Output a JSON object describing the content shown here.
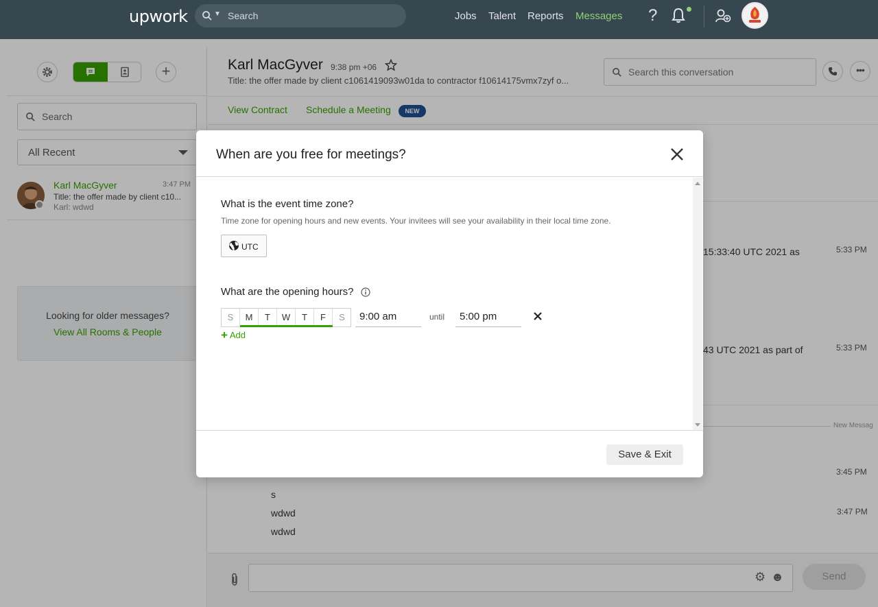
{
  "nav": {
    "logo": "upwork",
    "search_placeholder": "Search",
    "links": [
      "Jobs",
      "Talent",
      "Reports",
      "Messages"
    ],
    "active_link": "Messages",
    "help_label": "?",
    "accent": "#8fd07a"
  },
  "sidebar": {
    "search_placeholder": "Search",
    "filter_value": "All Recent",
    "rooms": [
      {
        "name": "Karl MacGyver",
        "time": "3:47 PM",
        "title": "Title: the offer made by client c10...",
        "last": "Karl: wdwd"
      }
    ],
    "older_prompt": "Looking for older messages?",
    "older_link": "View All Rooms & People"
  },
  "conversation": {
    "name": "Karl MacGyver",
    "local_time": "9:38 pm +06",
    "title": "Title: the offer made by client c1061419093w01da to contractor f10614175vmx7zyf o...",
    "search_placeholder": "Search this conversation",
    "tabs": [
      "View Contract",
      "Schedule a Meeting"
    ],
    "new_badge": "NEW",
    "messages": [
      {
        "text": "15:33:40 UTC 2021 as",
        "time": "5:33 PM"
      },
      {
        "text": "43 UTC 2021 as part of",
        "time": "5:33 PM"
      },
      {
        "text": "",
        "time": "3:45 PM"
      },
      {
        "text": "s",
        "time": ""
      },
      {
        "text": "wdwd",
        "time": "3:47 PM"
      },
      {
        "text": "wdwd",
        "time": ""
      }
    ],
    "new_messages_label": "New Messag",
    "send_label": "Send"
  },
  "modal": {
    "title": "When are you free for meetings?",
    "timezone_question": "What is the event time zone?",
    "timezone_hint": "Time zone for opening hours and new events. Your invitees will see your availability in their local time zone.",
    "timezone_value": "UTC",
    "hours_question": "What are the opening hours?",
    "days": [
      {
        "label": "S",
        "selected": false
      },
      {
        "label": "M",
        "selected": true
      },
      {
        "label": "T",
        "selected": true
      },
      {
        "label": "W",
        "selected": true
      },
      {
        "label": "T",
        "selected": true
      },
      {
        "label": "F",
        "selected": true
      },
      {
        "label": "S",
        "selected": false
      }
    ],
    "start_time": "9:00 am",
    "until_label": "until",
    "end_time": "5:00 pm",
    "add_label": "Add",
    "save_label": "Save & Exit"
  },
  "colors": {
    "nav_bg": "#37474f",
    "brand_green": "#37a000",
    "badge_blue": "#1d4f91"
  }
}
